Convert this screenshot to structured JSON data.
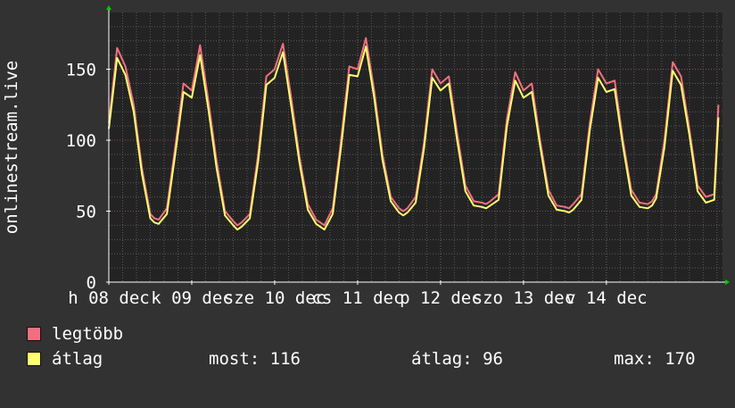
{
  "colors": {
    "background": "#323232",
    "plot_background": "#232323",
    "grid_minor": "#5a5a5a",
    "grid_major": "#7a5050",
    "axis": "#ffffff",
    "arrow": "#00cc00",
    "max_series": "#f07080",
    "avg_series": "#ffff70"
  },
  "chart_data": {
    "type": "line",
    "ylabel": "onlinestream.live",
    "ylim": [
      0,
      190
    ],
    "yticks": [
      0,
      50,
      100,
      150
    ],
    "grid": true,
    "xlim": [
      0,
      7.4
    ],
    "xticks": [
      {
        "x": 0,
        "label": "h 08 dec"
      },
      {
        "x": 1,
        "label": "k 09 dec"
      },
      {
        "x": 2,
        "label": "sze 10 dec"
      },
      {
        "x": 3,
        "label": "cs 11 dec"
      },
      {
        "x": 4,
        "label": "p 12 dec"
      },
      {
        "x": 5,
        "label": "szo 13 dec"
      },
      {
        "x": 6,
        "label": "v 14 dec"
      }
    ],
    "x": [
      0.0,
      0.1,
      0.2,
      0.3,
      0.4,
      0.5,
      0.55,
      0.6,
      0.7,
      0.8,
      0.9,
      1.0,
      1.1,
      1.2,
      1.3,
      1.4,
      1.5,
      1.55,
      1.6,
      1.7,
      1.8,
      1.9,
      2.0,
      2.1,
      2.2,
      2.3,
      2.4,
      2.5,
      2.55,
      2.6,
      2.7,
      2.8,
      2.9,
      3.0,
      3.1,
      3.2,
      3.3,
      3.4,
      3.5,
      3.55,
      3.6,
      3.7,
      3.8,
      3.9,
      4.0,
      4.1,
      4.2,
      4.3,
      4.4,
      4.5,
      4.55,
      4.6,
      4.7,
      4.8,
      4.9,
      5.0,
      5.1,
      5.2,
      5.3,
      5.4,
      5.5,
      5.55,
      5.6,
      5.7,
      5.8,
      5.9,
      6.0,
      6.1,
      6.2,
      6.3,
      6.4,
      6.5,
      6.55,
      6.6,
      6.7,
      6.8,
      6.9,
      7.0,
      7.1,
      7.2,
      7.3,
      7.35
    ],
    "series": [
      {
        "name": "legtöbb",
        "values": [
          112,
          165,
          152,
          125,
          80,
          48,
          45,
          44,
          52,
          95,
          140,
          135,
          167,
          128,
          85,
          50,
          43,
          40,
          42,
          48,
          90,
          145,
          150,
          168,
          130,
          88,
          55,
          44,
          42,
          40,
          52,
          100,
          152,
          150,
          172,
          135,
          90,
          60,
          52,
          50,
          52,
          60,
          98,
          150,
          140,
          145,
          105,
          68,
          57,
          56,
          55,
          57,
          62,
          115,
          148,
          135,
          140,
          100,
          65,
          54,
          53,
          52,
          55,
          62,
          112,
          150,
          140,
          142,
          100,
          65,
          56,
          55,
          57,
          62,
          100,
          155,
          145,
          108,
          68,
          60,
          62,
          125
        ]
      },
      {
        "name": "átlag",
        "values": [
          108,
          158,
          146,
          120,
          76,
          45,
          42,
          41,
          48,
          90,
          134,
          130,
          160,
          122,
          80,
          47,
          40,
          37,
          39,
          45,
          85,
          139,
          144,
          162,
          124,
          84,
          51,
          41,
          39,
          37,
          48,
          95,
          146,
          145,
          166,
          130,
          86,
          57,
          49,
          47,
          49,
          56,
          94,
          144,
          135,
          140,
          100,
          64,
          54,
          53,
          52,
          54,
          58,
          110,
          142,
          130,
          134,
          96,
          61,
          51,
          50,
          49,
          51,
          58,
          107,
          144,
          134,
          136,
          96,
          61,
          53,
          52,
          54,
          59,
          95,
          149,
          139,
          104,
          64,
          56,
          58,
          116
        ]
      }
    ]
  },
  "legend": [
    {
      "label": "legtöbb",
      "color": "#f07080"
    },
    {
      "label": "átlag",
      "color": "#ffff70"
    }
  ],
  "stats": {
    "now": "most: 116",
    "avg": "átlag: 96",
    "max": "max: 170"
  }
}
